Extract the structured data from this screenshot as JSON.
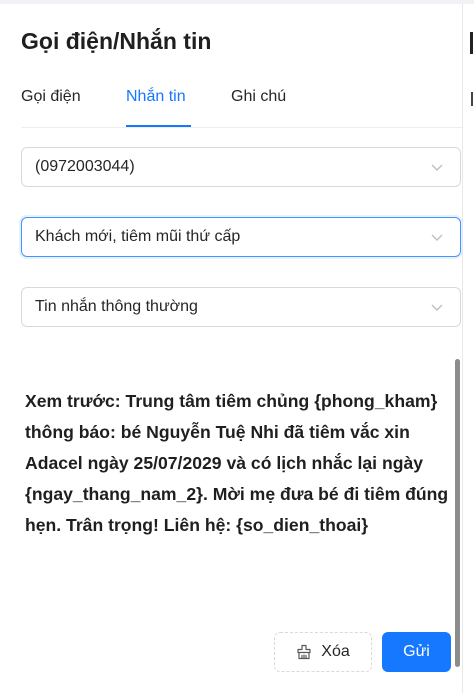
{
  "header": {
    "title": "Gọi điện/Nhắn tin"
  },
  "tabs": [
    {
      "label": "Gọi điện",
      "active": false
    },
    {
      "label": "Nhắn tin",
      "active": true
    },
    {
      "label": "Ghi chú",
      "active": false
    }
  ],
  "form": {
    "phone_select": {
      "value": "(0972003044)",
      "icon": "chevron-down-icon"
    },
    "template_select": {
      "value": "Khách mới, tiêm mũi thứ cấp",
      "icon": "chevron-down-icon",
      "focused": true
    },
    "message_type_select": {
      "value": "Tin nhắn thông thường",
      "icon": "chevron-down-icon"
    }
  },
  "preview": {
    "text": "Xem trước: Trung tâm tiêm chủng {phong_kham} thông báo: bé Nguyễn Tuệ Nhi đã tiêm vắc xin Adacel ngày 25/07/2029 và có lịch nhắc lại ngày {ngay_thang_nam_2}. Mời mẹ đưa bé đi tiêm đúng hẹn. Trân trọng! Liên hệ: {so_dien_thoai}"
  },
  "actions": {
    "delete_label": "Xóa",
    "delete_icon": "clear-icon",
    "send_label": "Gửi"
  },
  "colors": {
    "accent": "#1677ff",
    "text": "#1f1f1f",
    "border": "#d9d9d9",
    "background": "#f0f2f5"
  }
}
